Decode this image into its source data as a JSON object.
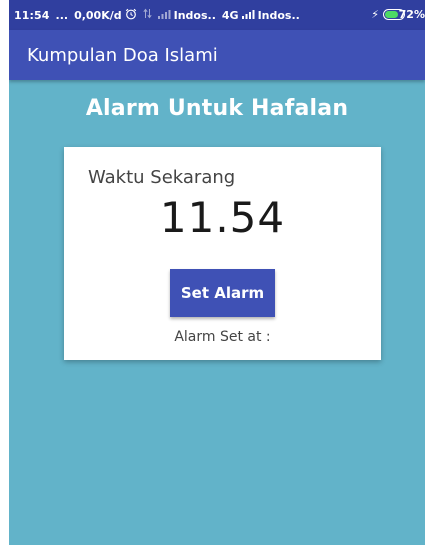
{
  "status_bar": {
    "time": "11:54",
    "more": "...",
    "speed": "0,00K/d",
    "carrier_1": "Indos..",
    "network_type": "4G",
    "carrier_2": "Indos..",
    "battery_percent": "72%",
    "battery_level": 0.72
  },
  "app_bar": {
    "title": "Kumpulan Doa Islami"
  },
  "page": {
    "heading": "Alarm Untuk Hafalan"
  },
  "card": {
    "label": "Waktu Sekarang",
    "current_time": "11.54",
    "button_label": "Set Alarm",
    "alarm_status": "Alarm Set at :"
  },
  "colors": {
    "background": "#62b3c9",
    "status_bar": "#303f9f",
    "app_bar": "#3f51b5",
    "button": "#3f51b5",
    "card": "#ffffff"
  },
  "icons": [
    "alarm-clock-icon",
    "data-arrows-icon",
    "signal-icon",
    "charging-bolt-icon",
    "battery-icon"
  ]
}
